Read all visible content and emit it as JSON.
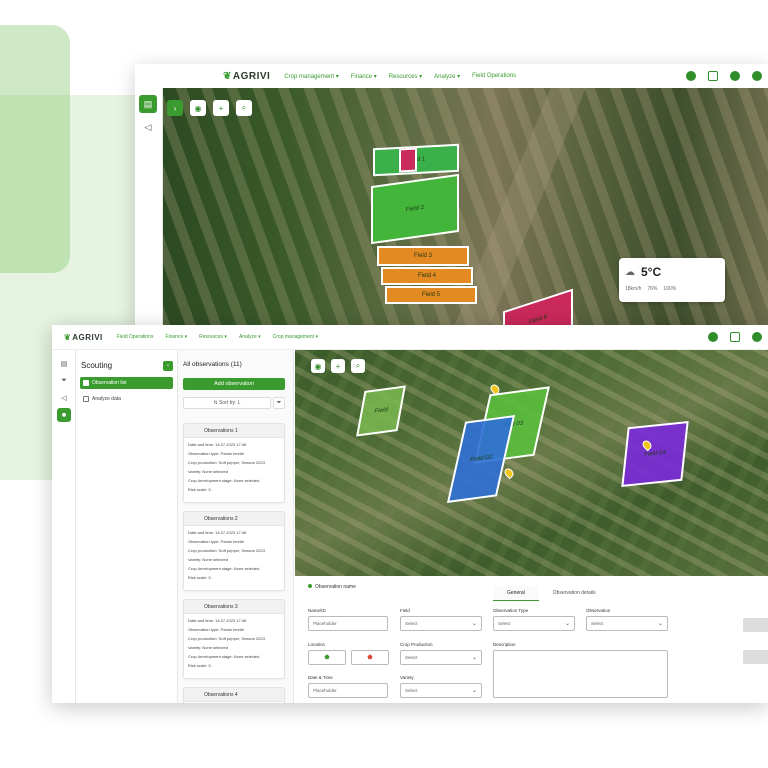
{
  "back": {
    "logo": "AGRIVI",
    "nav": [
      "Crop management ▾",
      "Finance ▾",
      "Resources ▾",
      "Analyze ▾",
      "Field Operations"
    ],
    "fields": [
      "Field 1",
      "Field 2",
      "Field 3",
      "Field 4",
      "Field 5",
      "Field 6",
      "Field 7"
    ],
    "weather": {
      "temp": "5°C",
      "wind": "18km/h",
      "humidity": "76%",
      "rain": "100%"
    }
  },
  "front": {
    "logo": "AGRIVI",
    "nav": [
      "Field Operations",
      "Finance ▾",
      "Resources ▾",
      "Analyze ▾",
      "Crop management ▾"
    ],
    "scouting": {
      "title": "Scouting",
      "items": [
        "Observation list",
        "Analyze data"
      ]
    },
    "observations": {
      "header": "All observations (11)",
      "add_label": "Add observation",
      "sort_label": "⇅ Sort by: L",
      "cards": [
        {
          "title": "Observations 1",
          "rows": [
            "Date and time: 14.07.2023 17:46",
            "Observation type: Potato beetle",
            "Crop production: Soft pepper, Season 2023",
            "Variety: None selected",
            "Crop development stage: None selected",
            "Risk scale: 5"
          ]
        },
        {
          "title": "Observations 2",
          "rows": [
            "Date and time: 14.07.2023 17:46",
            "Observation type: Potato beetle",
            "Crop production: Soft pepper, Season 2023",
            "Variety: None selected",
            "Crop development stage: None selected",
            "Risk scale: 5"
          ]
        },
        {
          "title": "Observations 3",
          "rows": [
            "Date and time: 14.07.2023 17:46",
            "Observation type: Potato beetle",
            "Crop production: Soft pepper, Season 2023",
            "Variety: None selected",
            "Crop development stage: None selected",
            "Risk scale: 5"
          ]
        },
        {
          "title": "Observations 4",
          "rows": []
        }
      ]
    },
    "map_fields": [
      "Field",
      "Field 02",
      "Field 03",
      "Field 04"
    ],
    "form": {
      "obs_name": "Observation name",
      "tabs": [
        "General",
        "Observation details"
      ],
      "name_label": "Name/ID",
      "name_value": "Placeholder",
      "field_label": "Field",
      "field_value": "Select",
      "type_label": "Observation Type",
      "type_value": "Select",
      "observation_label": "Observation",
      "observation_value": "Select",
      "location_label": "Location",
      "crop_label": "Crop Production",
      "crop_value": "Select",
      "description_label": "Description",
      "date_label": "Date & Time",
      "date_value": "Placeholder",
      "variety_label": "Variety",
      "variety_value": "Select"
    }
  },
  "colors": {
    "accent": "#3a9c2e",
    "orange": "#e8912a",
    "magenta": "#d0306a",
    "blue": "#2f6fd6",
    "purple": "#7a2bd6"
  }
}
